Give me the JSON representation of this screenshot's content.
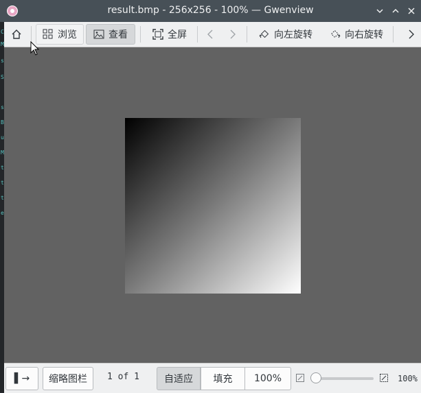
{
  "window": {
    "title": "result.bmp - 256x256 - 100% — Gwenview",
    "controls": [
      "minimize",
      "maximize",
      "close"
    ]
  },
  "toolbar": {
    "home_icon": "home-icon",
    "browse_label": "浏览",
    "view_label": "查看",
    "fullscreen_label": "全屏",
    "rotate_left_label": "向左旋转",
    "rotate_right_label": "向右旋转"
  },
  "viewer": {
    "background": "#626262",
    "image": {
      "gradient_from": "#000000",
      "gradient_to": "#ffffff"
    }
  },
  "statusbar": {
    "toggle_sidebar_label": "▌→",
    "thumbnail_bar_label": "缩略图栏",
    "page_counter": "1 of 1",
    "zoom_fit_label": "自适应",
    "zoom_fill_label": "填充",
    "zoom_100_label": "100%",
    "zoom_value": "100%",
    "zoom_slider_level": 0.0
  },
  "background_terminal": {
    "chars": [
      "C",
      "M",
      "s",
      "S",
      "s",
      "B",
      "u",
      "M",
      "t",
      "t",
      "t",
      "e"
    ]
  },
  "colors": {
    "titlebar": "#475057",
    "toolbar": "#eff0f1",
    "viewer": "#626262"
  }
}
